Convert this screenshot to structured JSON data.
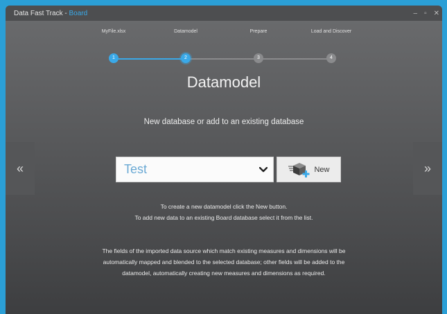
{
  "window": {
    "title_prefix": "Data Fast Track - ",
    "title_brand": "Board",
    "min": "–",
    "max": "▫",
    "close": "✕"
  },
  "steps": [
    {
      "label": "MyFile.xlsx",
      "number": "1",
      "state": "done"
    },
    {
      "label": "Datamodel",
      "number": "2",
      "state": "active"
    },
    {
      "label": "Prepare",
      "number": "3",
      "state": "todo"
    },
    {
      "label": "Load and Discover",
      "number": "4",
      "state": "todo"
    }
  ],
  "page": {
    "heading": "Datamodel",
    "subheading": "New database or add to an existing database"
  },
  "nav": {
    "prev": "«",
    "next": "»"
  },
  "database_select": {
    "value": "Test",
    "icon": "chevron-down-icon"
  },
  "new_button": {
    "label": "New",
    "icon": "new-database-icon"
  },
  "info": {
    "line1": "To create a new datamodel click the New button.",
    "line2": "To add new data to an existing Board database select it from the list.",
    "line3": "The fields of the imported data source which match existing measures and dimensions will be",
    "line4": "automatically mapped and blended to the selected database; other fields will be added to the",
    "line5": "datamodel, automatically creating new measures and dimensions as required."
  },
  "colors": {
    "accent": "#3aa9e8",
    "inactive_step": "#8a8b8d",
    "background": "#2b9fd6"
  }
}
